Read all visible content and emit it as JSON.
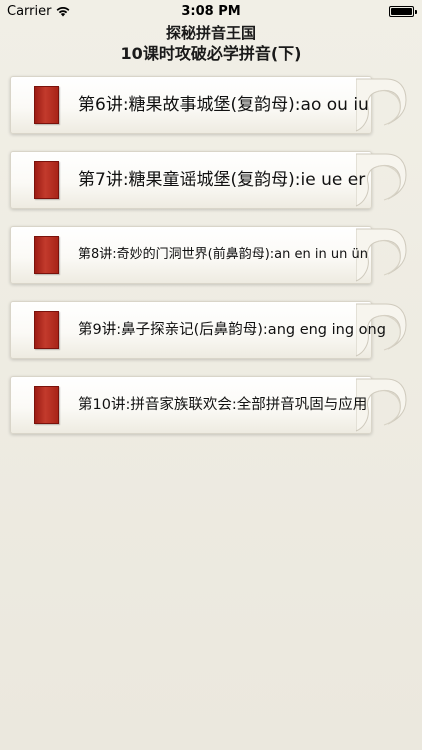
{
  "status_bar": {
    "carrier": "Carrier",
    "time": "3:08 PM",
    "icons": {
      "wifi": "wifi-icon",
      "battery": "battery-icon"
    }
  },
  "header": {
    "title": "探秘拼音王国",
    "subtitle": "10课时攻破必学拼音(下)"
  },
  "colors": {
    "background": "#efede4",
    "book_red": "#b32a1f"
  },
  "lessons": [
    {
      "label": "第6讲:糖果故事城堡(复韵母):ao ou iu",
      "icon": "red-book-icon"
    },
    {
      "label": "第7讲:糖果童谣城堡(复韵母):ie ue er",
      "icon": "red-book-icon"
    },
    {
      "label": "第8讲:奇妙的门洞世界(前鼻韵母):an en in un ün",
      "icon": "red-book-icon"
    },
    {
      "label": "第9讲:鼻子探亲记(后鼻韵母):ang eng ing ong",
      "icon": "red-book-icon"
    },
    {
      "label": "第10讲:拼音家族联欢会:全部拼音巩固与应用",
      "icon": "red-book-icon"
    }
  ]
}
